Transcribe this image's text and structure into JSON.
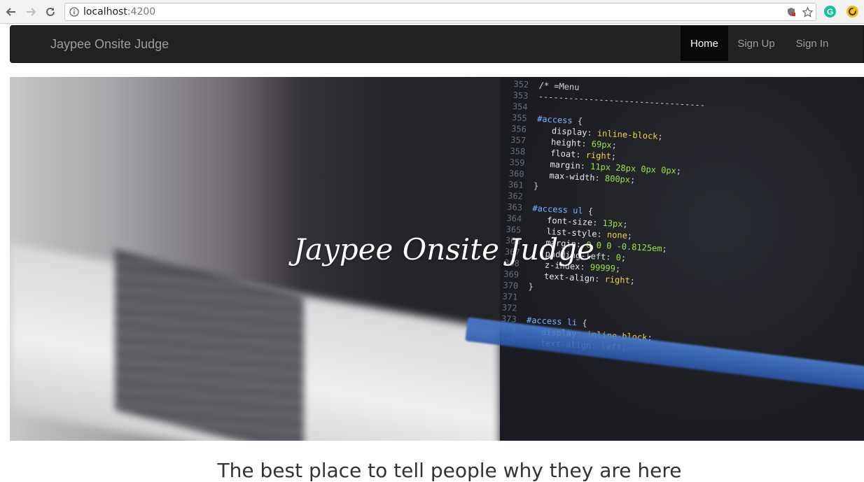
{
  "browser": {
    "url_host": "localhost",
    "url_port": ":4200",
    "icons": [
      "back-icon",
      "forward-icon",
      "reload-icon",
      "info-icon",
      "shield-icon",
      "star-icon",
      "grammarly-icon",
      "extension-icon"
    ]
  },
  "navbar": {
    "brand": "Jaypee Onsite Judge",
    "items": [
      {
        "label": "Home",
        "active": true
      },
      {
        "label": "Sign Up",
        "active": false
      },
      {
        "label": "Sign In",
        "active": false
      }
    ]
  },
  "hero": {
    "title": "Jaypee Onsite Judge"
  },
  "tagline": "The best place to tell people why they are here",
  "colors": {
    "navbar_bg": "#222222",
    "nav_active_bg": "#080808"
  }
}
